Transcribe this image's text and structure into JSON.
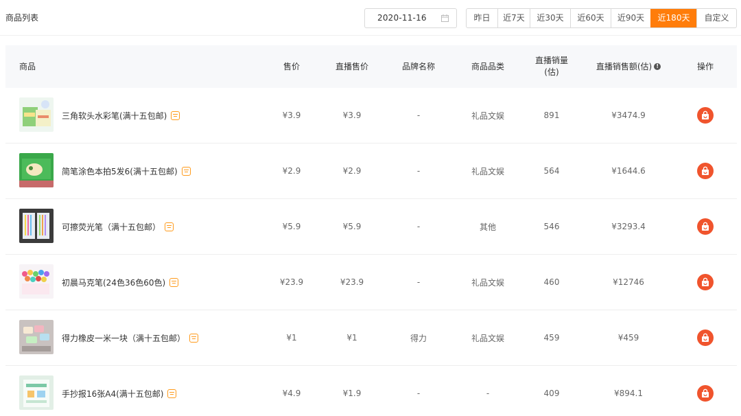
{
  "page": {
    "title": "商品列表"
  },
  "date_picker": {
    "value": "2020-11-16",
    "icon": "calendar-icon"
  },
  "ranges": [
    {
      "label": "昨日",
      "active": false
    },
    {
      "label": "近7天",
      "active": false
    },
    {
      "label": "近30天",
      "active": false
    },
    {
      "label": "近60天",
      "active": false
    },
    {
      "label": "近90天",
      "active": false
    },
    {
      "label": "近180天",
      "active": true
    },
    {
      "label": "自定义",
      "active": false
    }
  ],
  "table": {
    "headers": {
      "product": "商品",
      "price": "售价",
      "live_price": "直播售价",
      "brand": "品牌名称",
      "category": "商品品类",
      "sales_line1": "直播销量",
      "sales_line2": "(估)",
      "revenue": "直播销售额(估)",
      "action": "操作"
    },
    "rows": [
      {
        "name": "三角软头水彩笔(满十五包邮)",
        "price": "¥3.9",
        "live_price": "¥3.9",
        "brand": "-",
        "category": "礼品文娱",
        "sales": "891",
        "revenue": "¥3474.9"
      },
      {
        "name": "简笔涂色本拍5发6(满十五包邮)",
        "price": "¥2.9",
        "live_price": "¥2.9",
        "brand": "-",
        "category": "礼品文娱",
        "sales": "564",
        "revenue": "¥1644.6"
      },
      {
        "name": "可擦荧光笔（满十五包邮）",
        "price": "¥5.9",
        "live_price": "¥5.9",
        "brand": "-",
        "category": "其他",
        "sales": "546",
        "revenue": "¥3293.4"
      },
      {
        "name": "初晨马克笔(24色36色60色)",
        "price": "¥23.9",
        "live_price": "¥23.9",
        "brand": "-",
        "category": "礼品文娱",
        "sales": "460",
        "revenue": "¥12746"
      },
      {
        "name": "得力橡皮一米一块（满十五包邮）",
        "price": "¥1",
        "live_price": "¥1",
        "brand": "得力",
        "category": "礼品文娱",
        "sales": "459",
        "revenue": "¥459"
      },
      {
        "name": "手抄报16张A4(满十五包邮)",
        "price": "¥4.9",
        "live_price": "¥1.9",
        "brand": "-",
        "category": "-",
        "sales": "409",
        "revenue": "¥894.1"
      }
    ]
  },
  "colors": {
    "accent": "#ff7d0a",
    "action": "#f0542d",
    "tag": "#ff9a1a",
    "header_bg": "#f7f8fa"
  }
}
